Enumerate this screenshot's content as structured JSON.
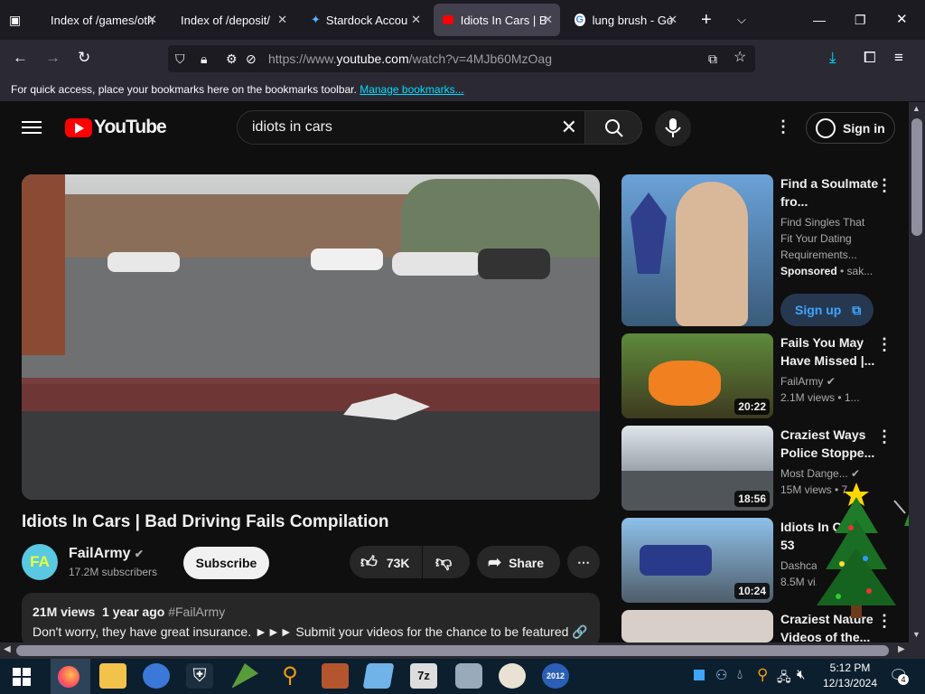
{
  "browser": {
    "tabs": [
      {
        "label": "Index of /games/oth",
        "active": false
      },
      {
        "label": "Index of /deposit/",
        "active": false
      },
      {
        "label": "Stardock Accou",
        "active": false
      },
      {
        "label": "Idiots In Cars | B",
        "active": true
      },
      {
        "label": "lung brush - Go",
        "active": false
      }
    ],
    "url_prefix": "https://www.",
    "url_domain": "youtube.com",
    "url_path": "/watch?v=4MJb60MzOag",
    "bookmarks_text": "For quick access, place your bookmarks here on the bookmarks toolbar.",
    "bookmarks_link": "Manage bookmarks..."
  },
  "youtube": {
    "logo": "YouTube",
    "search_value": "idiots in cars",
    "signin_label": "Sign in",
    "video": {
      "title": "Idiots In Cars | Bad Driving Fails Compilation",
      "channel": "FailArmy",
      "avatar_text": "FA",
      "subscribers": "17.2M subscribers",
      "subscribe_label": "Subscribe",
      "likes": "73K",
      "share_label": "Share",
      "views": "21M views",
      "age": "1 year ago",
      "hashtag": "#FailArmy",
      "description": "Don't worry, they have great insurance. ►►► Submit your videos for the chance to be featured 🔗"
    },
    "recommendations": [
      {
        "title": "Find a Soulmate fro...",
        "line1": "Find Singles That",
        "line2": "Fit Your Dating",
        "line3": "Requirements...",
        "sponsored": "Sponsored",
        "sponsor_name": "• sak...",
        "cta": "Sign up"
      },
      {
        "title": "Fails You May Have Missed |...",
        "channel": "FailArmy",
        "meta": "2.1M views  • 1...",
        "duration": "20:22"
      },
      {
        "title": "Craziest Ways Police Stoppe...",
        "channel": "Most Dange...",
        "meta": "15M views  • 7...",
        "duration": "18:56"
      },
      {
        "title": "Idiots In Ca...",
        "title2": "53",
        "channel": "Dashcam",
        "meta": "8.5M vi...",
        "duration": "10:24"
      },
      {
        "title": "Craziest Nature Videos of the..."
      }
    ]
  },
  "taskbar": {
    "time": "5:12 PM",
    "date": "12/13/2024",
    "notif_count": "4"
  },
  "colors": {
    "yt_red": "#ff0000",
    "firefox_bg": "#1c1b22",
    "accent": "#00ddff"
  }
}
